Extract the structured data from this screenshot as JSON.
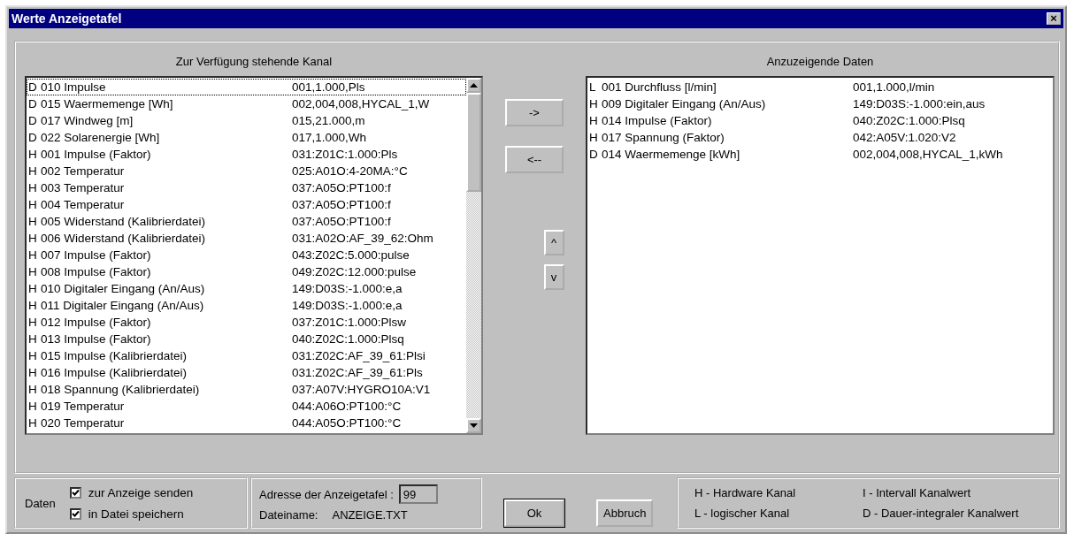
{
  "window": {
    "title": "Werte Anzeigetafel",
    "close": "×"
  },
  "available": {
    "heading": "Zur Verfügung stehende Kanal",
    "items": [
      {
        "type": "D",
        "name": "010 Impulse",
        "value": "001,1.000,Pls",
        "selected": true
      },
      {
        "type": "D",
        "name": "015 Waermemenge [Wh]",
        "value": "002,004,008,HYCAL_1,W",
        "selected": false
      },
      {
        "type": "D",
        "name": "017 Windweg [m]",
        "value": "015,21.000,m",
        "selected": false
      },
      {
        "type": "D",
        "name": "022 Solarenergie [Wh]",
        "value": "017,1.000,Wh",
        "selected": false
      },
      {
        "type": "H",
        "name": "001 Impulse (Faktor)",
        "value": "031:Z01C:1.000:Pls",
        "selected": false
      },
      {
        "type": "H",
        "name": "002 Temperatur",
        "value": "025:A01O:4-20MA:°C",
        "selected": false
      },
      {
        "type": "H",
        "name": "003 Temperatur",
        "value": "037:A05O:PT100:f",
        "selected": false
      },
      {
        "type": "H",
        "name": "004 Temperatur",
        "value": "037:A05O:PT100:f",
        "selected": false
      },
      {
        "type": "H",
        "name": "005 Widerstand (Kalibrierdatei)",
        "value": "037:A05O:PT100:f",
        "selected": false
      },
      {
        "type": "H",
        "name": "006 Widerstand (Kalibrierdatei)",
        "value": "031:A02O:AF_39_62:Ohm",
        "selected": false
      },
      {
        "type": "H",
        "name": "007 Impulse (Faktor)",
        "value": "043:Z02C:5.000:pulse",
        "selected": false
      },
      {
        "type": "H",
        "name": "008 Impulse (Faktor)",
        "value": "049:Z02C:12.000:pulse",
        "selected": false
      },
      {
        "type": "H",
        "name": "010 Digitaler Eingang (An/Aus)",
        "value": "149:D03S:-1.000:e,a",
        "selected": false
      },
      {
        "type": "H",
        "name": "011 Digitaler Eingang (An/Aus)",
        "value": "149:D03S:-1.000:e,a",
        "selected": false
      },
      {
        "type": "H",
        "name": "012 Impulse (Faktor)",
        "value": "037:Z01C:1.000:Plsw",
        "selected": false
      },
      {
        "type": "H",
        "name": "013 Impulse (Faktor)",
        "value": "040:Z02C:1.000:Plsq",
        "selected": false
      },
      {
        "type": "H",
        "name": "015 Impulse (Kalibrierdatei)",
        "value": "031:Z02C:AF_39_61:Plsi",
        "selected": false
      },
      {
        "type": "H",
        "name": "016 Impulse (Kalibrierdatei)",
        "value": "031:Z02C:AF_39_61:Pls",
        "selected": false
      },
      {
        "type": "H",
        "name": "018 Spannung (Kalibrierdatei)",
        "value": "037:A07V:HYGRO10A:V1",
        "selected": false
      },
      {
        "type": "H",
        "name": "019 Temperatur",
        "value": "044:A06O:PT100:°C",
        "selected": false
      },
      {
        "type": "H",
        "name": "020 Temperatur",
        "value": "044:A05O:PT100:°C",
        "selected": false
      }
    ]
  },
  "move_buttons": [
    "->",
    "<--"
  ],
  "order_buttons": [
    "^",
    "v"
  ],
  "displayed": {
    "heading": "Anzuzeigende Daten",
    "items": [
      {
        "type": "L",
        "name": "001 Durchfluss [l/min]",
        "value": "001,1.000,l/min"
      },
      {
        "type": "H",
        "name": "009 Digitaler Eingang (An/Aus)",
        "value": "149:D03S:-1.000:ein,aus"
      },
      {
        "type": "H",
        "name": "014 Impulse (Faktor)",
        "value": "040:Z02C:1.000:Plsq"
      },
      {
        "type": "H",
        "name": "017 Spannung (Faktor)",
        "value": "042:A05V:1.020:V2"
      },
      {
        "type": "D",
        "name": "014 Waermemenge [kWh]",
        "value": "002,004,008,HYCAL_1,kWh"
      }
    ]
  },
  "data_options": {
    "label": "Daten",
    "options": [
      {
        "label": "zur Anzeige senden",
        "checked": true
      },
      {
        "label": "in Datei speichern",
        "checked": true
      }
    ]
  },
  "address": {
    "label": "Adresse der Anzeigetafel :",
    "value": "99",
    "file_label": "Dateiname:",
    "file_name": "ANZEIGE.TXT"
  },
  "buttons": [
    "Ok",
    "Abbruch"
  ],
  "legend": [
    "H - Hardware Kanal",
    "I - Intervall Kanalwert",
    "L - logischer Kanal",
    "D - Dauer-integraler Kanalwert"
  ]
}
